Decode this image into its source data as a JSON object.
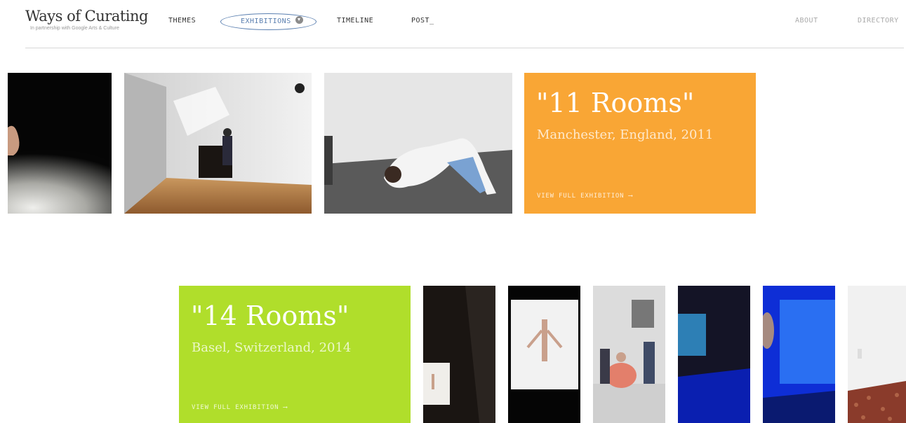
{
  "header": {
    "logo_title": "Ways of Curating",
    "logo_subtitle": "In partnership with Google Arts & Culture",
    "nav": {
      "themes": "THEMES",
      "exhibitions": "EXHIBITIONS",
      "timeline": "TIMELINE",
      "post": "POST_",
      "about": "ABOUT",
      "directory": "DIRECTORY"
    }
  },
  "exhibitions": [
    {
      "title": "\"11 Rooms\"",
      "subtitle": "Manchester, England, 2011",
      "link_label": "VIEW FULL EXHIBITION ⟶",
      "color": "#f9a635"
    },
    {
      "title": "\"14 Rooms\"",
      "subtitle": "Basel, Switzerland, 2014",
      "link_label": "VIEW FULL EXHIBITION ⟶",
      "color": "#b0de2b"
    }
  ],
  "colors": {
    "nav_active": "#5a7fb0",
    "divider": "#d8d8d8"
  }
}
